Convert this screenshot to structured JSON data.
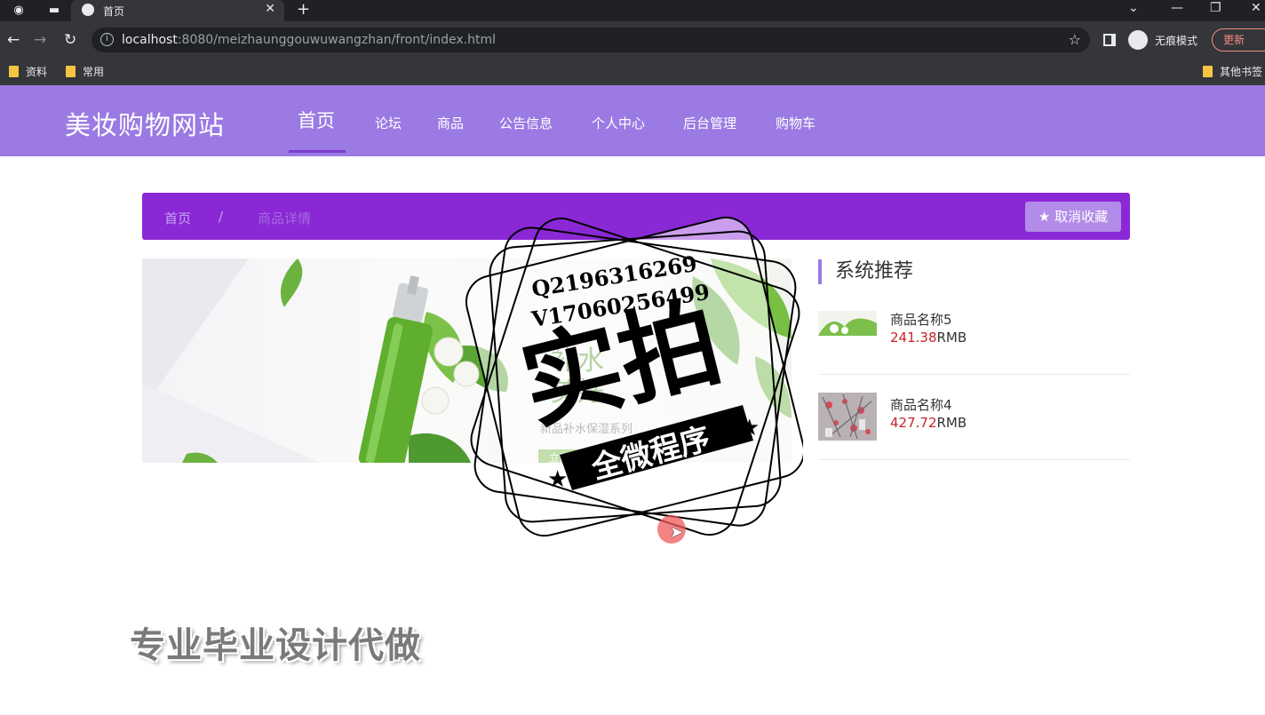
{
  "browser": {
    "tab_title": "首页",
    "tab_close": "✕",
    "new_tab": "+",
    "url_host": "localhost",
    "url_rest": ":8080/meizhaunggouwuwangzhan/front/index.html",
    "incognito_label": "无痕模式",
    "update_label": "更新",
    "bookmarks": [
      "资料",
      "常用"
    ],
    "other_bookmarks": "其他书签"
  },
  "site": {
    "logo": "美妆购物网站",
    "nav": {
      "home": "首页",
      "forum": "论坛",
      "goods": "商品",
      "notice": "公告信息",
      "profile": "个人中心",
      "admin": "后台管理",
      "cart": "购物车"
    }
  },
  "breadcrumb": {
    "home": "首页",
    "separator": "/",
    "current": "商品详情"
  },
  "unfavorite_button": "取消收藏",
  "banner": {
    "line1": "补水",
    "line2": "美好",
    "subtitle": "新品补水保湿系列",
    "cta": "立即"
  },
  "recommend": {
    "title": "系统推荐",
    "items": [
      {
        "name": "商品名称5",
        "price": "241.38",
        "unit": "RMB"
      },
      {
        "name": "商品名称4",
        "price": "427.72",
        "unit": "RMB"
      }
    ]
  },
  "watermark": {
    "qq": "Q2196316269",
    "wechat": "V17060256499",
    "big": "实拍",
    "ribbon": "全微程序",
    "promo": "专业毕业设计代做"
  },
  "colors": {
    "header": "#9b7ae3",
    "crumbbar": "#8a28d6",
    "price": "#c8232c"
  }
}
